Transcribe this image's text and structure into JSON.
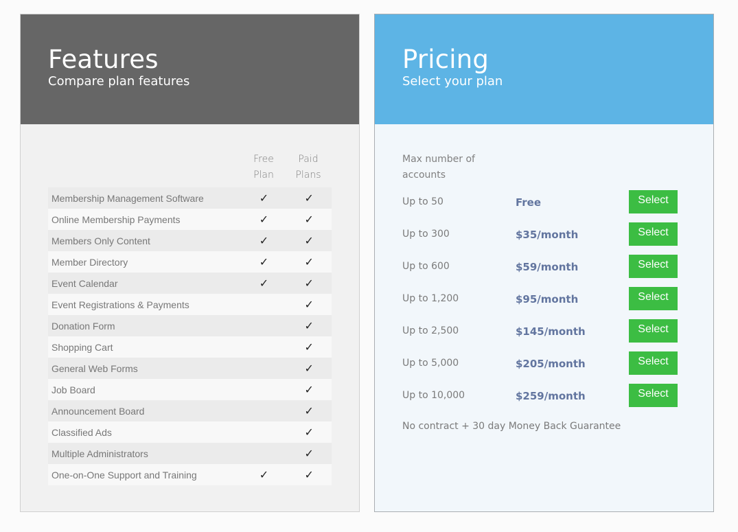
{
  "features": {
    "title": "Features",
    "subtitle": "Compare plan features",
    "colors": {
      "header_bg": "#666666",
      "body_bg": "#f1f1f1"
    },
    "columns": [
      {
        "line1": "Free",
        "line2": "Plan"
      },
      {
        "line1": "Paid",
        "line2": "Plans"
      }
    ],
    "check_glyph": "✓",
    "rows": [
      {
        "name": "Membership Management Software",
        "free": true,
        "paid": true
      },
      {
        "name": "Online Membership Payments",
        "free": true,
        "paid": true
      },
      {
        "name": "Members Only Content",
        "free": true,
        "paid": true
      },
      {
        "name": "Member Directory",
        "free": true,
        "paid": true
      },
      {
        "name": "Event Calendar",
        "free": true,
        "paid": true
      },
      {
        "name": "Event Registrations & Payments",
        "free": false,
        "paid": true
      },
      {
        "name": "Donation Form",
        "free": false,
        "paid": true
      },
      {
        "name": "Shopping Cart",
        "free": false,
        "paid": true
      },
      {
        "name": "General Web Forms",
        "free": false,
        "paid": true
      },
      {
        "name": "Job Board",
        "free": false,
        "paid": true
      },
      {
        "name": "Announcement Board",
        "free": false,
        "paid": true
      },
      {
        "name": "Classified Ads",
        "free": false,
        "paid": true
      },
      {
        "name": "Multiple Administrators",
        "free": false,
        "paid": true
      },
      {
        "name": "One-on-One Support and Training",
        "free": true,
        "paid": true
      }
    ]
  },
  "pricing": {
    "title": "Pricing",
    "subtitle": "Select your plan",
    "colors": {
      "header_bg": "#5db4e5",
      "price_text": "#62759f",
      "button_bg": "#3cbd43"
    },
    "column_header": {
      "line1": "Max number of",
      "line2": "accounts"
    },
    "plans": [
      {
        "accounts": "Up to 50",
        "price": "Free",
        "button": "Select"
      },
      {
        "accounts": "Up to 300",
        "price": "$35/month",
        "button": "Select"
      },
      {
        "accounts": "Up to 600",
        "price": "$59/month",
        "button": "Select"
      },
      {
        "accounts": "Up to 1,200",
        "price": "$95/month",
        "button": "Select"
      },
      {
        "accounts": "Up to 2,500",
        "price": "$145/month",
        "button": "Select"
      },
      {
        "accounts": "Up to 5,000",
        "price": "$205/month",
        "button": "Select"
      },
      {
        "accounts": "Up to 10,000",
        "price": "$259/month",
        "button": "Select"
      }
    ],
    "guarantee": "No contract + 30 day Money Back Guarantee"
  }
}
